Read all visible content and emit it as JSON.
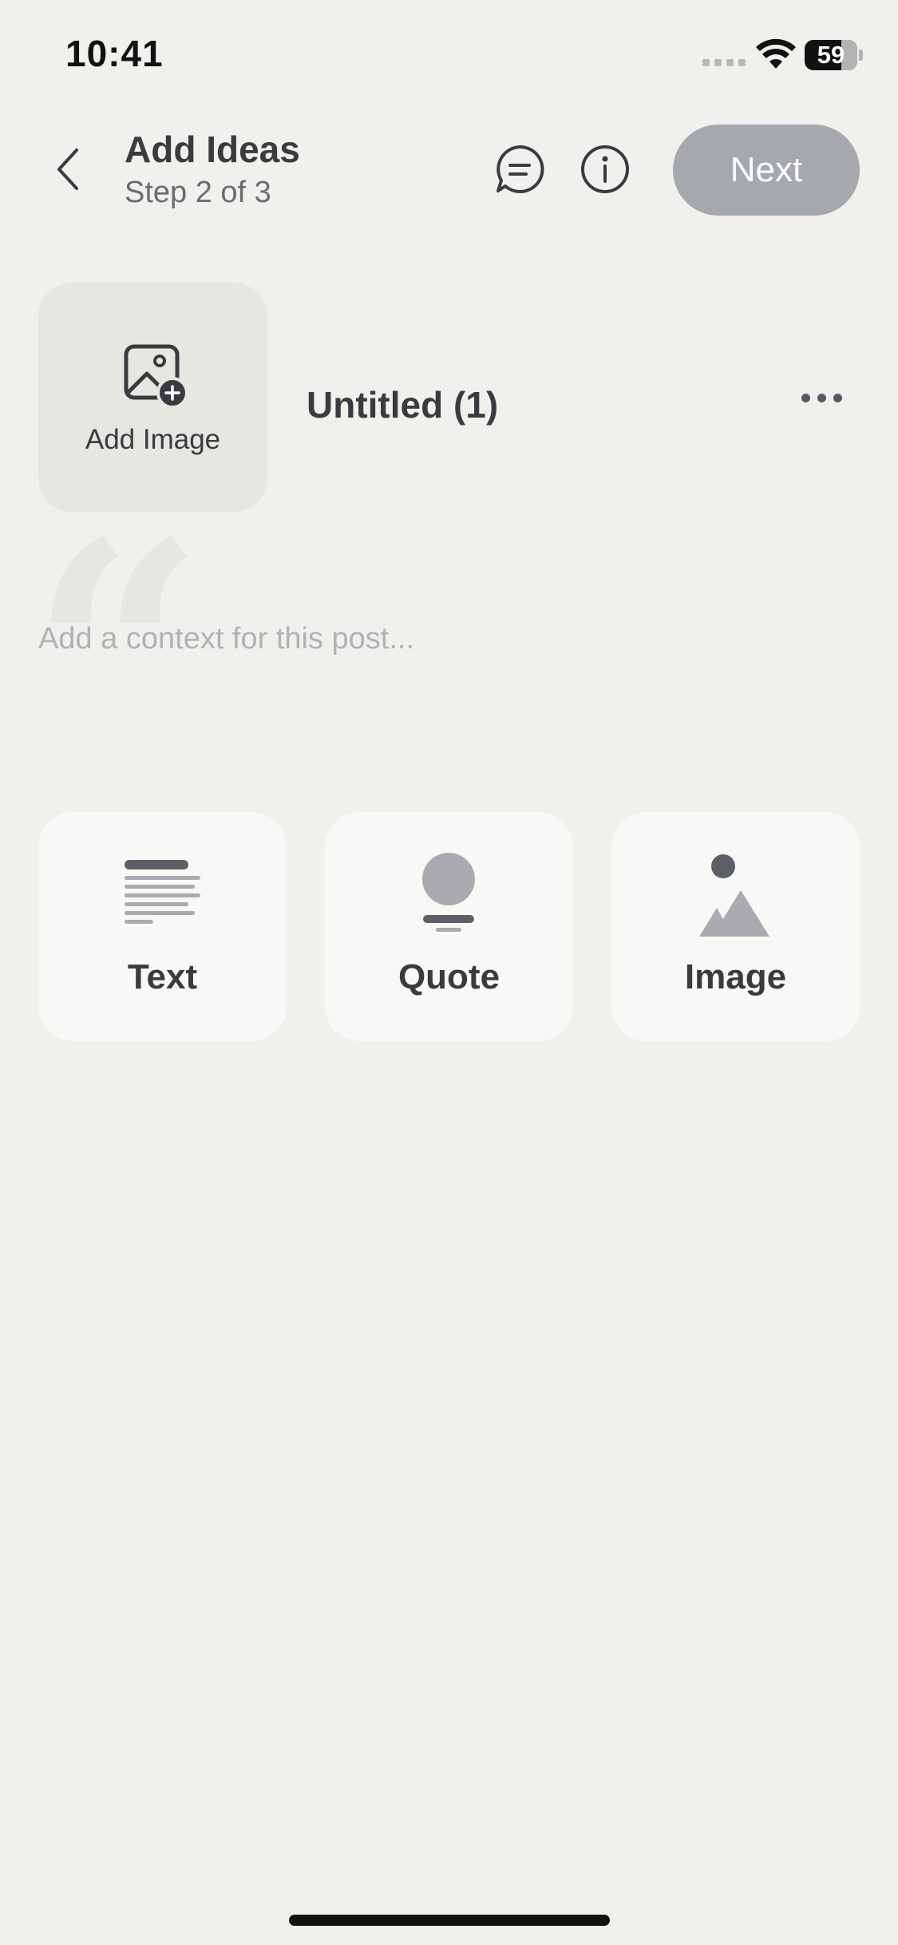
{
  "status_bar": {
    "time": "10:41",
    "battery": "59"
  },
  "header": {
    "title": "Add Ideas",
    "subtitle": "Step 2 of 3",
    "next_label": "Next"
  },
  "post": {
    "add_image_label": "Add Image",
    "title": "Untitled (1)",
    "context_placeholder": "Add a context for this post...",
    "quote_glyph": "“"
  },
  "blocks": [
    {
      "label": "Text",
      "icon": "text-block-icon"
    },
    {
      "label": "Quote",
      "icon": "quote-block-icon"
    },
    {
      "label": "Image",
      "icon": "image-block-icon"
    }
  ],
  "colors": {
    "background": "#f1f0ed",
    "next_button": "#a5a8ad",
    "card": "#f8f8f6",
    "add_image_tile": "#e8e6e1",
    "text_primary": "#3a3b40"
  }
}
